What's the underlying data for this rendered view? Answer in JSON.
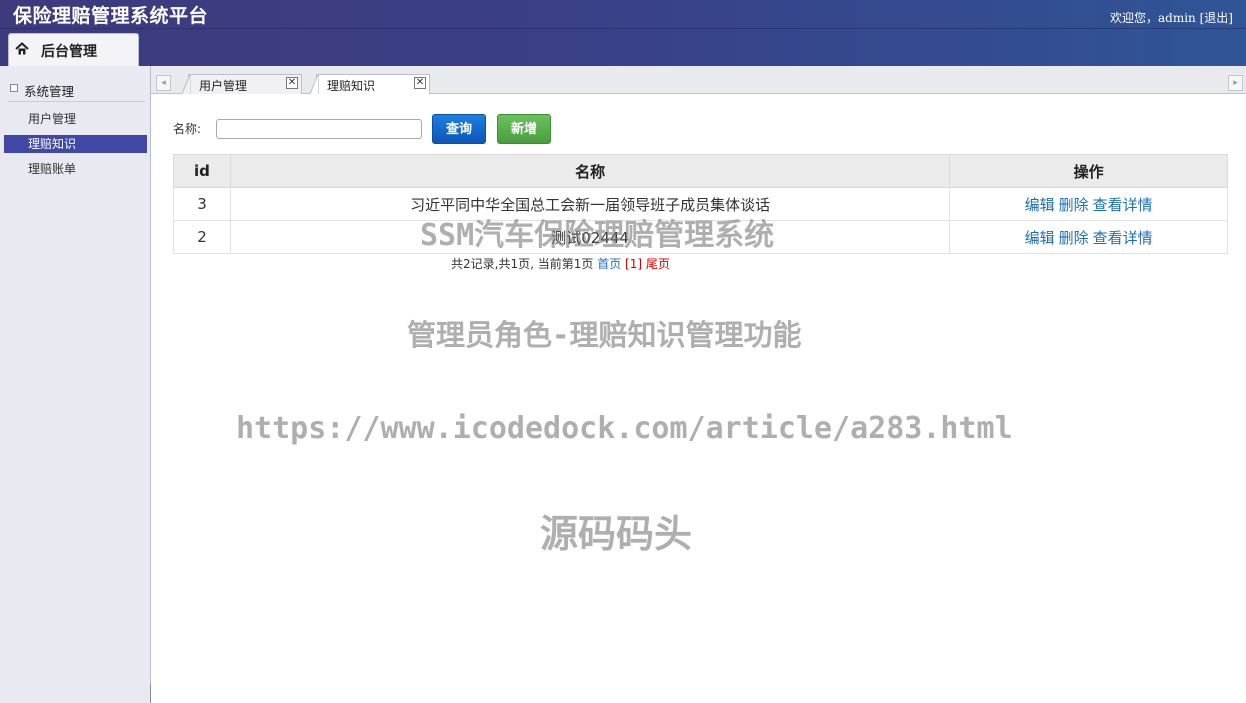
{
  "app": {
    "title": "保险理赔管理系统平台",
    "welcome": "欢迎您，admin",
    "logout": "[退出]",
    "main_tab": "后台管理"
  },
  "sidebar": {
    "group_label": "系统管理",
    "items": [
      {
        "label": "用户管理",
        "active": false
      },
      {
        "label": "理赔知识",
        "active": true
      },
      {
        "label": "理赔账单",
        "active": false
      }
    ]
  },
  "tabs": [
    {
      "label": "用户管理",
      "active": false
    },
    {
      "label": "理赔知识",
      "active": true
    }
  ],
  "search": {
    "label": "名称:",
    "value": "",
    "query_button": "查询",
    "add_button": "新增"
  },
  "table": {
    "headers": [
      "id",
      "名称",
      "操作"
    ],
    "rows": [
      {
        "id": "3",
        "name": "习近平同中华全国总工会新一届领导班子成员集体谈话",
        "actions": [
          "编辑",
          "删除",
          "查看详情"
        ]
      },
      {
        "id": "2",
        "name": "测试02444",
        "actions": [
          "编辑",
          "删除",
          "查看详情"
        ]
      }
    ]
  },
  "pager": {
    "summary": "共2记录,共1页, 当前第1页",
    "first": "首页",
    "current": "[1]",
    "last": "尾页"
  },
  "watermarks": [
    "SSM汽车保险理赔管理系统",
    "管理员角色-理赔知识管理功能",
    "https://www.icodedock.com/article/a283.html",
    "源码码头"
  ],
  "colors": {
    "header_start": "#3e3a7e",
    "header_end": "#2f5596",
    "sidebar_active": "#3f48a5",
    "link": "#1d6fb6",
    "pager_red": "#d80000",
    "query_button": "#0c56b8",
    "add_button": "#4a9e3e"
  },
  "icons": {
    "main_tab": "home-icon",
    "tab_close": "close-icon",
    "tab_scroll_left": "chevron-left-icon",
    "tab_scroll_right": "chevron-right-icon"
  }
}
